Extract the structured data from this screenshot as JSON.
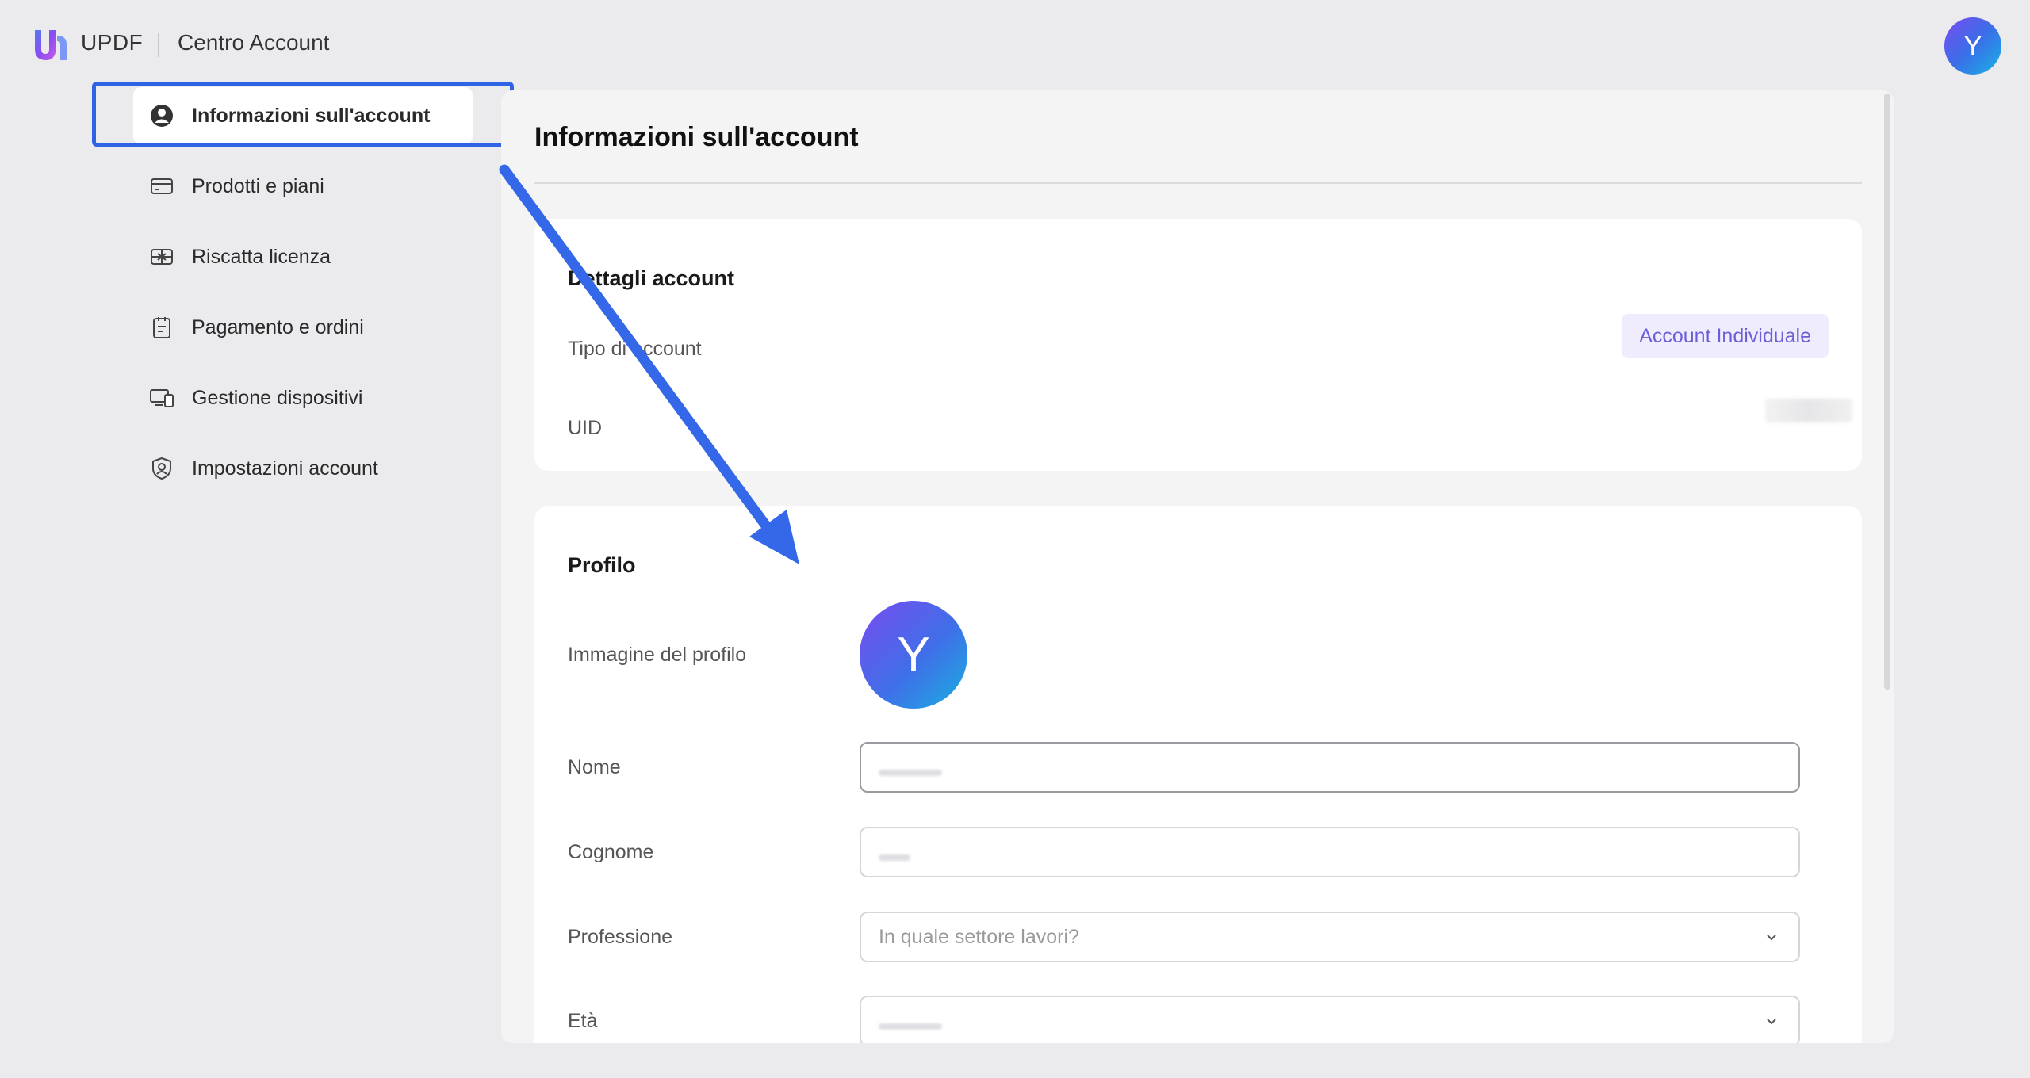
{
  "app": {
    "brand": "UPDF",
    "title": "Centro Account",
    "avatar_initial": "Y"
  },
  "sidebar": {
    "items": [
      {
        "label": "Informazioni sull'account",
        "icon": "user-circle-icon",
        "active": true
      },
      {
        "label": "Prodotti e piani",
        "icon": "card-icon",
        "active": false
      },
      {
        "label": "Riscatta licenza",
        "icon": "gift-icon",
        "active": false
      },
      {
        "label": "Pagamento e ordini",
        "icon": "clipboard-icon",
        "active": false
      },
      {
        "label": "Gestione dispositivi",
        "icon": "devices-icon",
        "active": false
      },
      {
        "label": "Impostazioni account",
        "icon": "shield-user-icon",
        "active": false
      }
    ]
  },
  "main": {
    "title": "Informazioni sull'account",
    "details": {
      "title": "Dettagli account",
      "account_type_label": "Tipo di account",
      "account_type_value": "Account Individuale",
      "uid_label": "UID"
    },
    "profile": {
      "title": "Profilo",
      "image_label": "Immagine del profilo",
      "avatar_initial": "Y",
      "name_label": "Nome",
      "surname_label": "Cognome",
      "profession_label": "Professione",
      "profession_placeholder": "In quale settore lavori?",
      "age_label": "Età"
    }
  },
  "colors": {
    "accent": "#2f63e6",
    "badge_bg": "#efedfd",
    "badge_text": "#6b5fd8",
    "background": "#ebebed"
  }
}
